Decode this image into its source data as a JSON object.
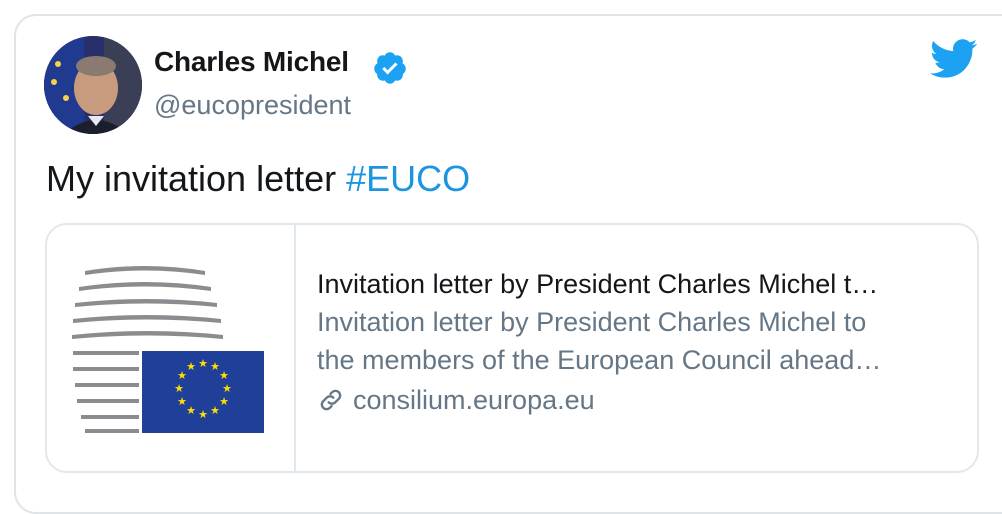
{
  "tweet": {
    "author": {
      "name": "Charles Michel",
      "handle": "@eucopresident",
      "verified": true
    },
    "text": "My invitation letter ",
    "hashtag": "#EUCO",
    "card": {
      "title": "Invitation letter by President Charles Michel t…",
      "description_line1": "Invitation letter by President Charles Michel to",
      "description_line2": "the members of the European Council ahead…",
      "domain": "consilium.europa.eu",
      "thumbnail_icon": "european-council-logo"
    },
    "colors": {
      "link_blue": "#1b95e0",
      "twitter_blue": "#1da1f2",
      "secondary_text": "#657786",
      "eu_flag_blue": "#1f3f99",
      "eu_star_yellow": "#ffdd00"
    }
  }
}
